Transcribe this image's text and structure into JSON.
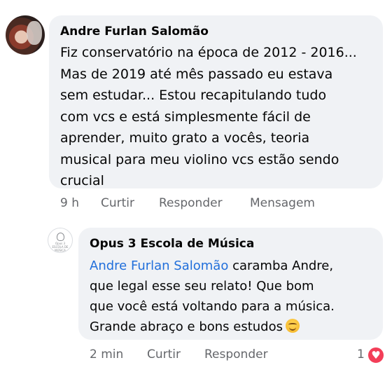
{
  "comment": {
    "author": "Andre Furlan Salomão",
    "text": "Fiz conservatório na época de 2012 - 2016...\nMas de 2019 até mês passado eu estava\nsem estudar... Estou recapitulando tudo\ncom vcs e está simplesmente fácil de\naprender, muito grato a vocês, teoria\nmusical para meu violino vcs estão sendo\ncrucial",
    "time": "9 h",
    "like_label": "Curtir",
    "reply_label": "Responder",
    "message_label": "Mensagem"
  },
  "reply": {
    "author": "Opus 3 Escola de Música",
    "avatar_text": "Opus 3 ESCOLA DE MÚSICA",
    "mention": "Andre Furlan Salomão",
    "text_first_line_rest": " caramba Andre,",
    "text_rest": "que legal esse seu relato! Que bom\nque você está voltando para a música.\nGrande abraço e bons estudos",
    "emoji": "smiling-face",
    "time": "2 min",
    "like_label": "Curtir",
    "reply_label": "Responder",
    "reaction_count": "1",
    "reaction_type": "heart"
  },
  "colors": {
    "bubble": "#f0f2f5",
    "secondary_text": "#65676b",
    "mention": "#216fdb",
    "heart": "#f33e58"
  }
}
